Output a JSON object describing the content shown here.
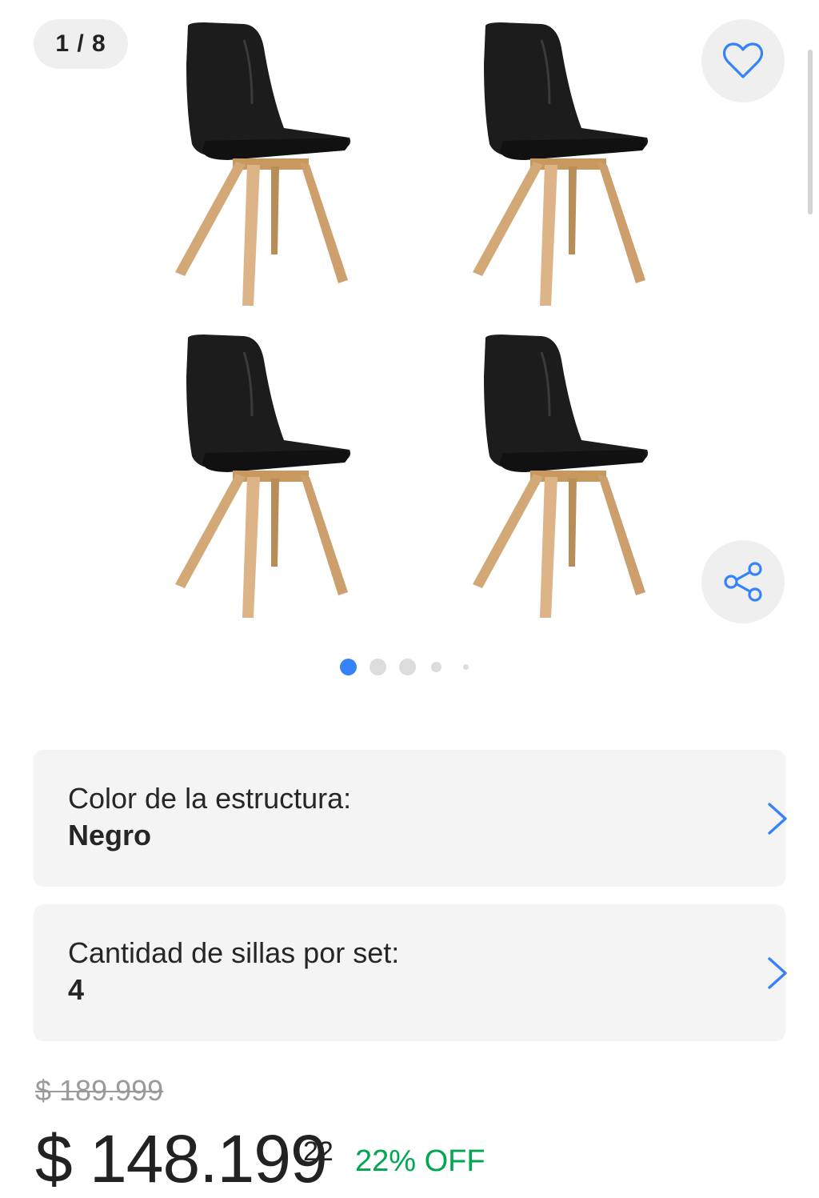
{
  "gallery": {
    "counter": "1 / 8",
    "image_count": 8,
    "current_image": 1,
    "image_description_icon": "chair-photo",
    "favorite_icon": "heart-icon",
    "share_icon": "share-icon",
    "accent_color": "#3483fa"
  },
  "variations": [
    {
      "label": "Color de la estructura:",
      "value": "Negro"
    },
    {
      "label": "Cantidad de sillas por set:",
      "value": "4"
    }
  ],
  "price": {
    "original": "$ 189.999",
    "current_main": "$ 148.199",
    "current_cents": "22",
    "discount": "22% OFF",
    "discount_color": "#00a650"
  }
}
